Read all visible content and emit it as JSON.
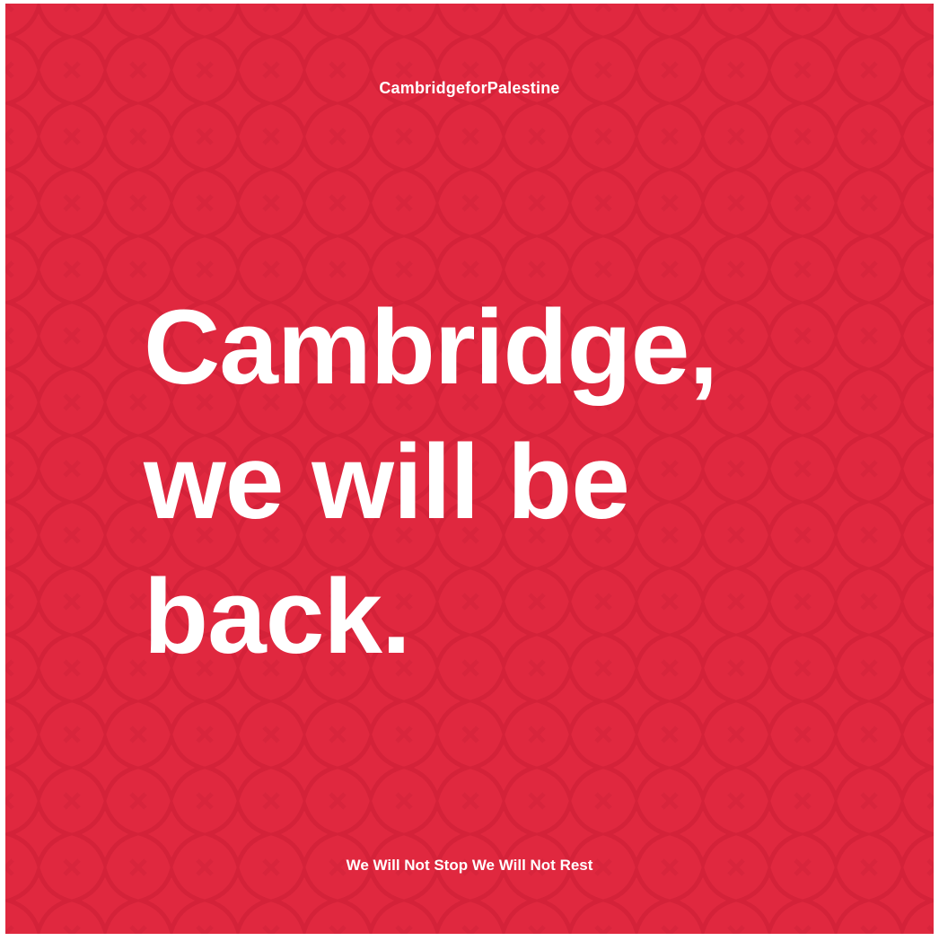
{
  "poster": {
    "handle": "CambridgeforPalestine",
    "headline_lines": [
      "Cambridge,",
      "we will be",
      "back."
    ],
    "tagline": "We Will Not Stop We Will Not Rest",
    "background_color": "#e0283f",
    "pattern_color": "#c81d34",
    "text_color": "#ffffff"
  }
}
